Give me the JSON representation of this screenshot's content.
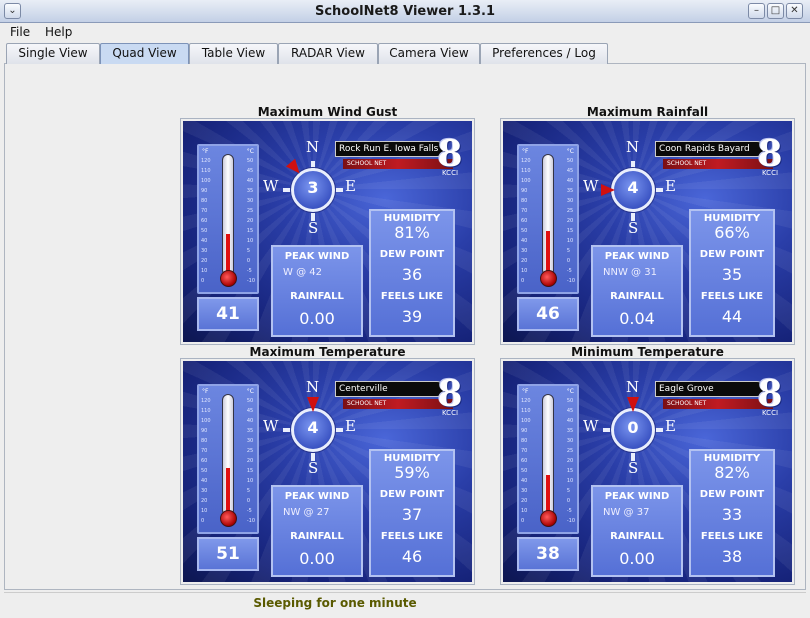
{
  "window": {
    "title": "SchoolNet8 Viewer 1.3.1"
  },
  "menu": {
    "file": "File",
    "help": "Help"
  },
  "tabs": [
    {
      "label": "Single View",
      "active": false
    },
    {
      "label": "Quad View",
      "active": true
    },
    {
      "label": "Table View",
      "active": false
    },
    {
      "label": "RADAR View",
      "active": false
    },
    {
      "label": "Camera View",
      "active": false
    },
    {
      "label": "Preferences / Log",
      "active": false
    }
  ],
  "labels": {
    "peak_wind": "PEAK WIND",
    "rainfall": "RAINFALL",
    "humidity": "HUMIDITY",
    "dew_point": "DEW POINT",
    "feels_like": "FEELS LIKE",
    "schoolnet": "SCHOOL NET",
    "kcci": "KCCI",
    "logo": "8",
    "compass": {
      "n": "N",
      "s": "S",
      "e": "E",
      "w": "W"
    },
    "unit_f": "°F",
    "unit_c": "°C"
  },
  "panels": [
    {
      "title": "Maximum Wind Gust",
      "station": "Rock Run E. Iowa Falls",
      "temp": "41",
      "wind_speed": "3",
      "peak_wind": "W   @ 42",
      "rainfall": "0.00",
      "humidity": "81%",
      "dew_point": "36",
      "feels_like": "39",
      "arrow_dir": "NW",
      "mercury_level": 0.52
    },
    {
      "title": "Maximum Rainfall",
      "station": "Coon Rapids Bayard",
      "temp": "46",
      "wind_speed": "4",
      "peak_wind": "NNW @ 31",
      "rainfall": "0.04",
      "humidity": "66%",
      "dew_point": "35",
      "feels_like": "44",
      "arrow_dir": "W",
      "mercury_level": 0.56
    },
    {
      "title": "Maximum Temperature",
      "station": "Centerville",
      "temp": "51",
      "wind_speed": "4",
      "peak_wind": "NW  @ 27",
      "rainfall": "0.00",
      "humidity": "59%",
      "dew_point": "37",
      "feels_like": "46",
      "arrow_dir": "N",
      "mercury_level": 0.6
    },
    {
      "title": "Minimum Temperature",
      "station": "Eagle Grove",
      "temp": "38",
      "wind_speed": "0",
      "peak_wind": "NW  @ 37",
      "rainfall": "0.00",
      "humidity": "82%",
      "dew_point": "33",
      "feels_like": "38",
      "arrow_dir": "N",
      "mercury_level": 0.5
    }
  ],
  "status": "Sleeping for one minute",
  "colors": {
    "mercury": "#e01010",
    "arrow": "#d01010",
    "accent_blue": "#2a3ea8"
  }
}
